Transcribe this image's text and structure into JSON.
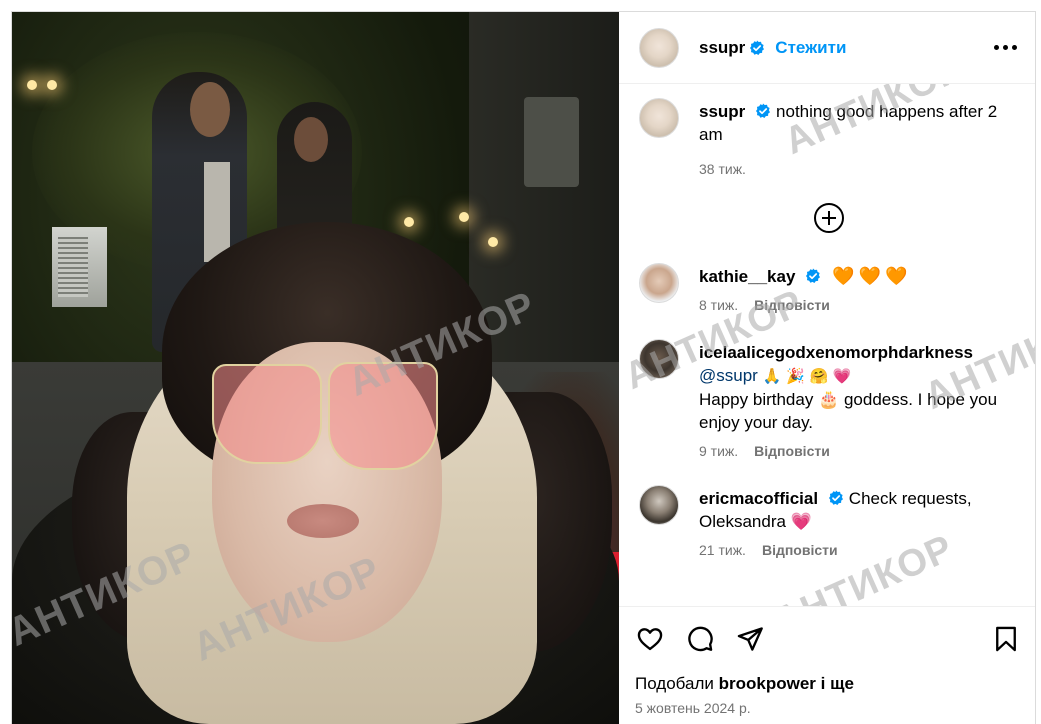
{
  "post": {
    "author": {
      "username": "ssupr",
      "verified": true,
      "follow_label": "Стежити",
      "more_label": "more-options"
    },
    "caption": {
      "username": "ssupr",
      "text": "nothing good happens after 2 am",
      "time": "38 тиж."
    },
    "load_more_icon": "plus-circle-icon",
    "comments": [
      {
        "username": "kathie__kay",
        "verified": true,
        "text": "🧡🧡🧡",
        "time": "8 тиж.",
        "reply_label": "Відповісти"
      },
      {
        "username": "icelaalicegodxenomorphdarkness",
        "verified": false,
        "mention": "@ssupr",
        "text_line1": "🙏 🎉 🤗 💗",
        "text_line2": "Happy birthday 🎂 goddess. I hope you enjoy your day.",
        "time": "9 тиж.",
        "reply_label": "Відповісти"
      },
      {
        "username": "ericmacofficial",
        "verified": true,
        "text": "Check requests, Oleksandra 💗",
        "time": "21 тиж.",
        "reply_label": "Відповісти"
      }
    ],
    "actions": {
      "like_icon": "heart-icon",
      "comment_icon": "comment-icon",
      "share_icon": "send-icon",
      "save_icon": "bookmark-icon"
    },
    "likes": {
      "prefix": "Подобали",
      "user": "brookpower",
      "suffix": "і ще"
    },
    "date": "5 жовтень 2024 р."
  },
  "watermark": "АНТИКОР",
  "colors": {
    "link_blue": "#0095f6",
    "verified_blue": "#0095f6",
    "muted_text": "#737373",
    "mention": "#00376b",
    "border": "#dbdbdb"
  }
}
